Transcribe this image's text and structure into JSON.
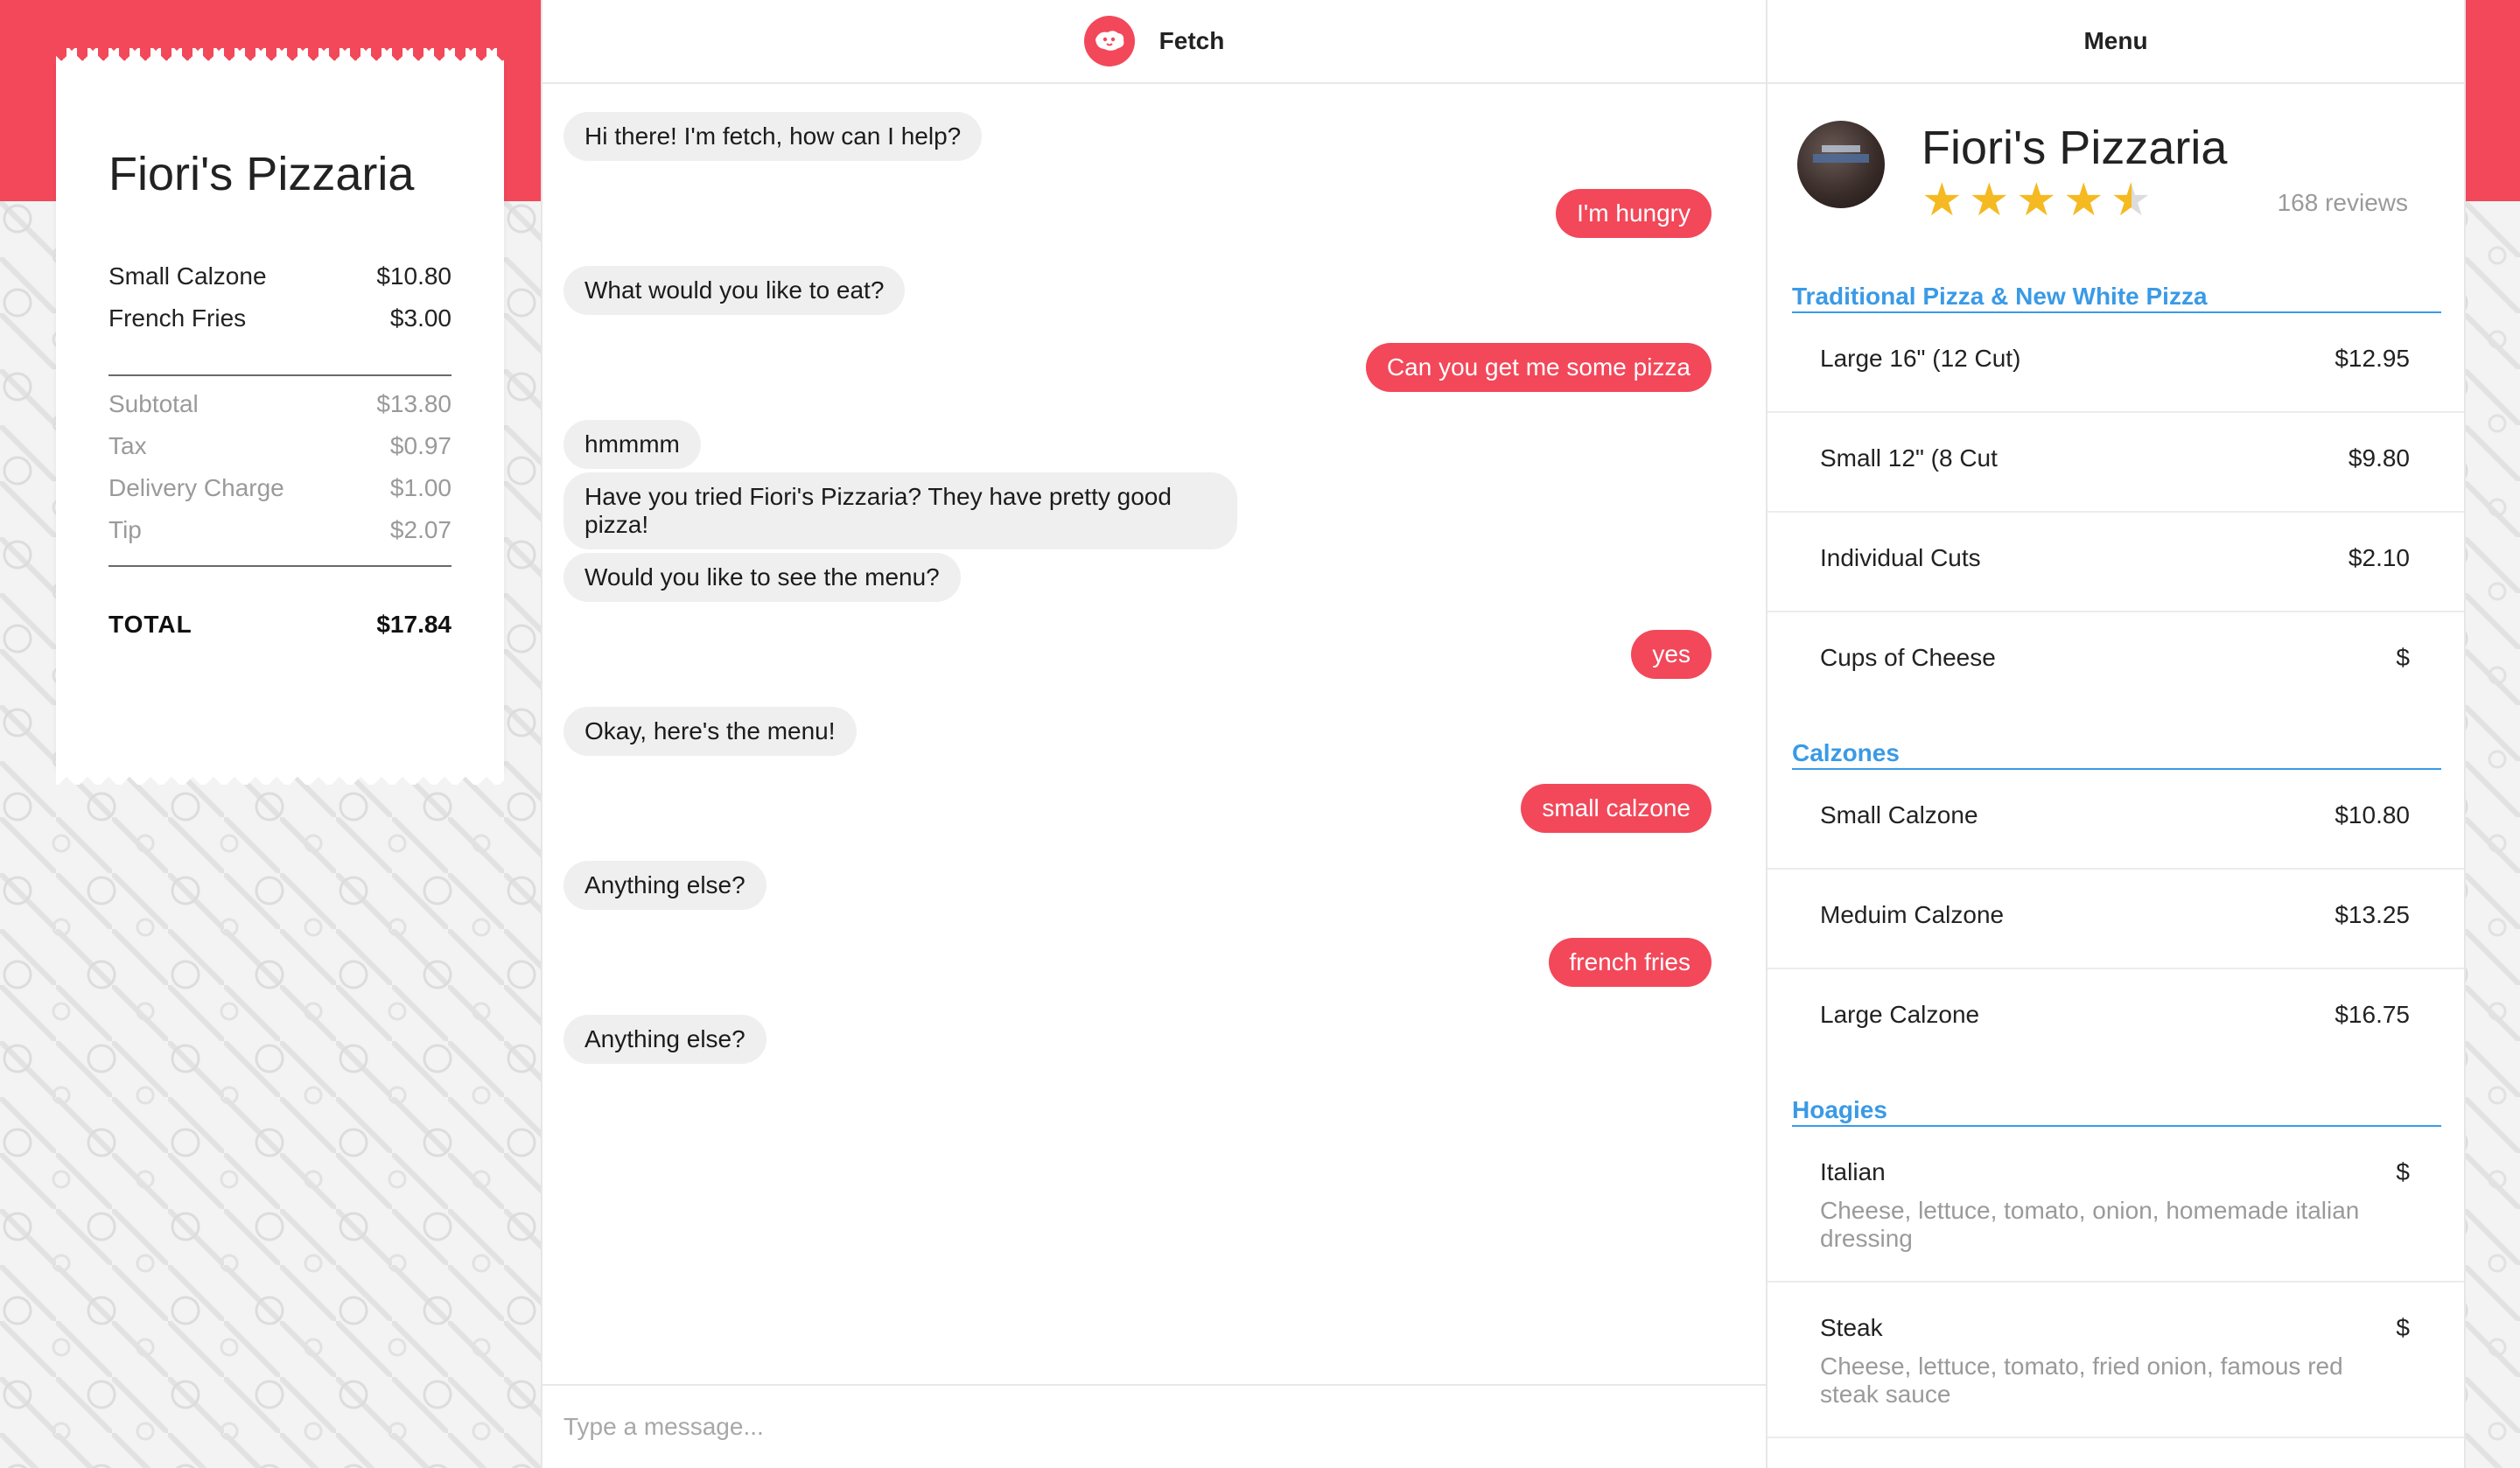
{
  "colors": {
    "accent": "#f2485a",
    "section": "#3a9ae6",
    "star": "#f5b921"
  },
  "receipt": {
    "restaurant": "Fiori's Pizzaria",
    "items": [
      {
        "name": "Small Calzone",
        "price": "$10.80"
      },
      {
        "name": "French Fries",
        "price": "$3.00"
      }
    ],
    "subtotal_label": "Subtotal",
    "subtotal": "$13.80",
    "tax_label": "Tax",
    "tax": "$0.97",
    "delivery_label": "Delivery Charge",
    "delivery": "$1.00",
    "tip_label": "Tip",
    "tip": "$2.07",
    "total_label": "TOTAL",
    "total": "$17.84"
  },
  "chat": {
    "title": "Fetch",
    "logo_icon": "fetch-dog-logo",
    "messages": [
      {
        "from": "bot",
        "text": "Hi there! I'm fetch, how can I help?"
      },
      {
        "from": "user",
        "text": "I'm hungry"
      },
      {
        "from": "bot",
        "text": "What would you like to eat?"
      },
      {
        "from": "user",
        "text": "Can you get me some pizza"
      },
      {
        "from": "bot",
        "text": "hmmmm"
      },
      {
        "from": "bot",
        "text": "Have you tried Fiori's Pizzaria? They have pretty good pizza!"
      },
      {
        "from": "bot",
        "text": "Would you like to see the menu?"
      },
      {
        "from": "user",
        "text": "yes"
      },
      {
        "from": "bot",
        "text": "Okay, here's the menu!"
      },
      {
        "from": "user",
        "text": "small calzone"
      },
      {
        "from": "bot",
        "text": "Anything else?"
      },
      {
        "from": "user",
        "text": "french fries"
      },
      {
        "from": "bot",
        "text": "Anything else?"
      }
    ],
    "input_placeholder": "Type a message..."
  },
  "menu": {
    "title": "Menu",
    "restaurant": "Fiori's Pizzaria",
    "rating": 4.5,
    "rating_max": 5,
    "reviews": "168 reviews",
    "sections": [
      {
        "title": "Traditional Pizza & New White Pizza",
        "items": [
          {
            "name": "Large 16\" (12 Cut)",
            "price": "$12.95"
          },
          {
            "name": "Small 12\" (8 Cut",
            "price": "$9.80"
          },
          {
            "name": "Individual Cuts",
            "price": "$2.10"
          },
          {
            "name": "Cups of Cheese",
            "price": "$"
          }
        ]
      },
      {
        "title": "Calzones",
        "items": [
          {
            "name": "Small Calzone",
            "price": "$10.80"
          },
          {
            "name": "Meduim Calzone",
            "price": "$13.25"
          },
          {
            "name": "Large Calzone",
            "price": "$16.75"
          }
        ]
      },
      {
        "title": "Hoagies",
        "items": [
          {
            "name": "Italian",
            "price": "$",
            "desc": "Cheese, lettuce, tomato, onion, homemade italian dressing"
          },
          {
            "name": "Steak",
            "price": "$",
            "desc": "Cheese, lettuce, tomato, fried onion, famous red steak sauce"
          }
        ]
      }
    ]
  }
}
